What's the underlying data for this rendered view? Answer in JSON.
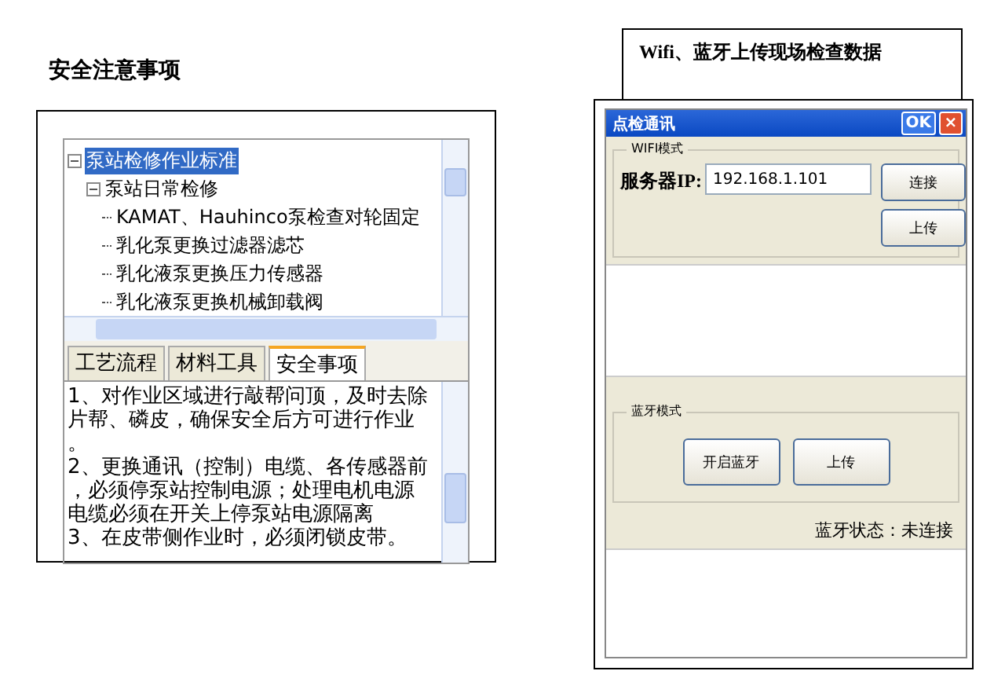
{
  "left": {
    "heading": "安全注意事项",
    "tree": [
      {
        "label": "泵站检修作业标准",
        "expanded": true,
        "selected": true,
        "children": [
          {
            "label": "泵站日常检修",
            "expanded": true,
            "selected": false,
            "children": [
              {
                "label": "KAMAT、Hauhinco泵检查对轮固定",
                "selected": false
              },
              {
                "label": "乳化泵更换过滤器滤芯",
                "selected": false
              },
              {
                "label": "乳化液泵更换压力传感器",
                "selected": false
              },
              {
                "label": "乳化液泵更换机械卸载阀",
                "selected": false
              }
            ]
          }
        ]
      }
    ],
    "tabs": [
      {
        "label": "工艺流程",
        "selected": false
      },
      {
        "label": "材料工具",
        "selected": false
      },
      {
        "label": "安全事项",
        "selected": true
      }
    ],
    "content_lines": [
      "1、对作业区域进行敲帮问顶，及时去除",
      "片帮、磷皮，确保安全后方可进行作业",
      "。",
      "2、更换通讯（控制）电缆、各传感器前",
      "，必须停泵站控制电源；处理电机电源",
      "电缆必须在开关上停泵站电源隔离",
      "3、在皮带侧作业时，必须闭锁皮带。"
    ]
  },
  "right": {
    "caption": "Wifi、蓝牙上传现场检查数据",
    "window": {
      "title": "点检通讯",
      "ok": "OK",
      "close": "×"
    },
    "wifi": {
      "legend": "WIFI模式",
      "server_label": "服务器IP:",
      "server_ip": "192.168.1.101",
      "buttons": [
        "连接",
        "上传"
      ]
    },
    "bluetooth": {
      "legend": "蓝牙模式",
      "buttons": [
        "开启蓝牙",
        "上传"
      ],
      "status": "蓝牙状态：未连接"
    }
  }
}
